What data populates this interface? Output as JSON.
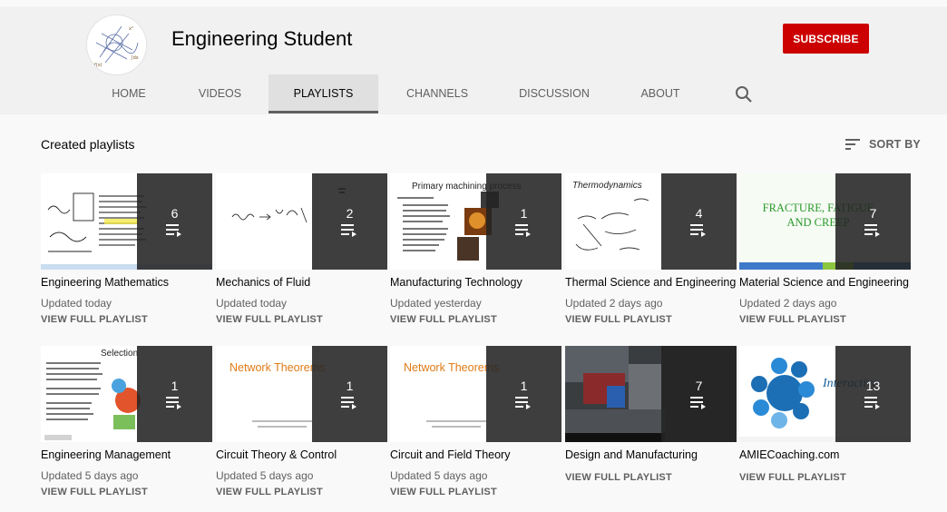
{
  "channel": {
    "title": "Engineering Student",
    "subscribe_label": "SUBSCRIBE"
  },
  "tabs": [
    {
      "label": "HOME"
    },
    {
      "label": "VIDEOS"
    },
    {
      "label": "PLAYLISTS",
      "active": true
    },
    {
      "label": "CHANNELS"
    },
    {
      "label": "DISCUSSION"
    },
    {
      "label": "ABOUT"
    }
  ],
  "shelf": {
    "title": "Created playlists",
    "sort_label": "SORT BY"
  },
  "colors": {
    "subscribe": "#cc0000",
    "overlay": "#232323",
    "meta_text": "#606060",
    "page_bg": "#f9f9f9"
  },
  "icons": {
    "search": "search-icon",
    "sort": "sort-icon",
    "playlist": "playlist-icon"
  },
  "playlists": [
    {
      "title": "Engineering Mathematics",
      "count": "6",
      "updated": "Updated today",
      "link": "VIEW FULL PLAYLIST"
    },
    {
      "title": "Mechanics of Fluid",
      "count": "2",
      "updated": "Updated today",
      "link": "VIEW FULL PLAYLIST"
    },
    {
      "title": "Manufacturing Technology",
      "count": "1",
      "updated": "Updated yesterday",
      "link": "VIEW FULL PLAYLIST",
      "thumb_text": "Primary machining process"
    },
    {
      "title": "Thermal Science and Engineering",
      "count": "4",
      "updated": "Updated 2 days ago",
      "link": "VIEW FULL PLAYLIST",
      "thumb_text": "Thermodynamics"
    },
    {
      "title": "Material Science and Engineering",
      "count": "7",
      "updated": "Updated 2 days ago",
      "link": "VIEW FULL PLAYLIST",
      "thumb_text": "FRACTURE, FATIGUE AND CREEP"
    },
    {
      "title": "Engineering Management",
      "count": "1",
      "updated": "Updated 5 days ago",
      "link": "VIEW FULL PLAYLIST",
      "thumb_text": "Selection"
    },
    {
      "title": "Circuit Theory & Control",
      "count": "1",
      "updated": "Updated 5 days ago",
      "link": "VIEW FULL PLAYLIST",
      "thumb_text": "Network Theorems"
    },
    {
      "title": "Circuit and Field Theory",
      "count": "1",
      "updated": "Updated 5 days ago",
      "link": "VIEW FULL PLAYLIST",
      "thumb_text": "Network Theorems"
    },
    {
      "title": "Design and Manufacturing",
      "count": "7",
      "updated": "",
      "link": "VIEW FULL PLAYLIST"
    },
    {
      "title": "AMIECoaching.com",
      "count": "13",
      "updated": "",
      "link": "VIEW FULL PLAYLIST",
      "thumb_text": "Interactive"
    }
  ]
}
